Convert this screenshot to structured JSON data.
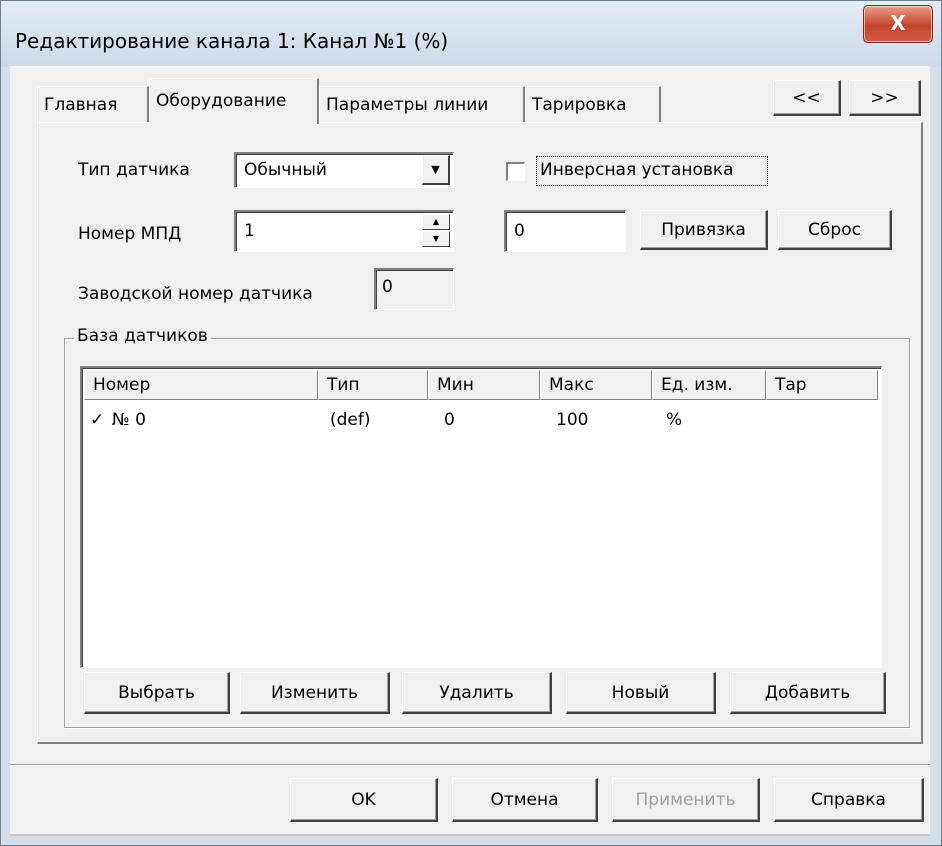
{
  "window": {
    "title": "Редактирование канала 1:  Канал №1 (%)",
    "close_glyph": "X"
  },
  "tabs": [
    {
      "label": "Главная",
      "active": false
    },
    {
      "label": "Оборудование",
      "active": true
    },
    {
      "label": "Параметры линии",
      "active": false
    },
    {
      "label": "Тарировка",
      "active": false
    }
  ],
  "nav": {
    "prev_label": "<<",
    "next_label": ">>"
  },
  "form": {
    "sensor_type_label": "Тип датчика",
    "sensor_type_value": "Обычный",
    "inverse_label": "Инверсная установка",
    "inverse_checked": false,
    "mpd_label": "Номер МПД",
    "mpd_value": "1",
    "binding_value": "0",
    "bind_button": "Привязка",
    "reset_button": "Сброс",
    "serial_label": "Заводской номер датчика",
    "serial_value": "0"
  },
  "sensor_base": {
    "title": "База датчиков",
    "columns": [
      "Номер",
      "Тип",
      "Мин",
      "Макс",
      "Ед. изм.",
      "Тар"
    ],
    "rows": [
      {
        "check": "✓",
        "number": "№ 0",
        "type": "(def)",
        "min": "0",
        "max": "100",
        "unit": "%",
        "tar": ""
      }
    ],
    "buttons": {
      "select": "Выбрать",
      "edit": "Изменить",
      "delete": "Удалить",
      "new": "Новый",
      "add": "Добавить"
    }
  },
  "footer": {
    "ok": "OK",
    "cancel": "Отмена",
    "apply": "Применить",
    "help": "Справка"
  }
}
